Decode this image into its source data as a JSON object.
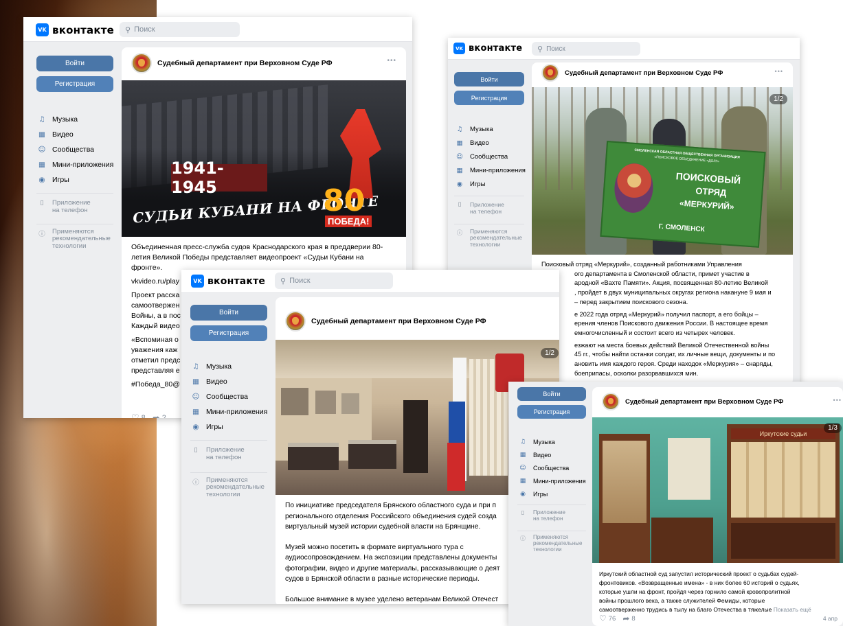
{
  "vk": {
    "brand": "вконтакте",
    "logo_letter": "VK",
    "search_placeholder": "Поиск",
    "login": "Войти",
    "register": "Регистрация",
    "menu": [
      "Музыка",
      "Видео",
      "Сообщества",
      "Мини-приложения",
      "Игры"
    ],
    "app_link_1": "Приложение",
    "app_link_2": "на телефон",
    "rec_1": "Применяются",
    "rec_2": "рекомендательные",
    "rec_3": "технологии"
  },
  "colors": {
    "accent": "#0077ff",
    "button": "#4a76a8",
    "link": "#2a5885",
    "muted": "#818c99"
  },
  "page_name": "Судебный департамент при Верховном Суде РФ",
  "post1": {
    "years": "1941-1945",
    "slogan": "СУДЬИ КУБАНИ НА ФРОНТЕ",
    "badge_80": "80",
    "badge_pobeda": "ПОБЕДА!",
    "text_1": "Объединенная пресс-служба судов Краснодарского края в преддверии 80-",
    "text_2": "летия Великой Победы представляет видеопроект «Судьи Кубани на",
    "text_3": "фронте».",
    "link": "vkvideo.ru/play",
    "p2_1": "Проект расска",
    "p2_2": "самоотвержен",
    "p2_3": "Войны, а в пос",
    "p2_4": "Каждый видео",
    "p3_1": "«Вспоминая о",
    "p3_2": "уважения каж",
    "p3_3": "отметил предс",
    "p3_4": "представляя е",
    "hashtag": "#Победа_80@",
    "likes": "8",
    "shares": "2"
  },
  "post2": {
    "counter": "1/2",
    "flag_1": "СМОЛЕНСКАЯ ОБЛАСТНАЯ ОБЩЕСТВЕННАЯ ОРГАНИЗАЦИЯ",
    "flag_2": "«ПОИСКОВОЕ ОБЪЕДИНЕНИЕ «ДОЛГ»",
    "flag_3": "ПОИСКОВЫЙ",
    "flag_4": "ОТРЯД",
    "flag_5": "«МЕРКУРИЙ»",
    "flag_6": "Г. СМОЛЕНСК",
    "t1": "Поисковый отряд «Меркурий», созданный работниками Управления",
    "t2": "ого департамента в Смоленской области, примет участие в",
    "t3": "ародной «Вахте Памяти». Акция, посвященная 80-летию Великой",
    "t4": ", пройдет в двух муниципальных округах региона накануне 9 мая и",
    "t5": "– перед закрытием поискового сезона.",
    "t6": "е 2022 года отряд «Меркурий» получил паспорт, а его бойцы –",
    "t7": "ерения членов Поискового движения России. В настоящее время",
    "t8": "емногочисленный и состоит всего из четырех человек.",
    "t9": "езжают на места боевых действий Великой Отечественной войны",
    "t10": "45 гг., чтобы найти останки солдат, их личные вещи, документы и по",
    "t11": "ановить имя каждого героя. Среди находок «Меркурия» – снаряды,",
    "t12": "боеприпасы, осколки разорвавшихся мин."
  },
  "post3": {
    "counter": "1/2",
    "t1": "По инициативе председателя Брянского областного суда и при п",
    "t2": "регионального отделения Российского объединения судей созда",
    "t3": "виртуальный музей истории судебной власти на Брянщине.",
    "t4": "Музей можно посетить в формате виртуального тура с",
    "t5": "аудиосопровождением. На экспозиции представлены документы",
    "t6": "фотографии, видео и другие материалы, рассказывающие о деят",
    "t7": "судов в Брянской области в разные исторические периоды.",
    "t8": "Большое внимание в музее уделено ветеранам Великой Отечест"
  },
  "post4": {
    "counter": "1/3",
    "banner": "Иркутские судьи",
    "t1": "Иркутский областной суд запустил исторический проект о судьбах судей-",
    "t2": "фронтовиков. «Возвращенные имена» - в них более 60 историй о судьях,",
    "t3": "которые ушли на фронт, пройдя через горнило самой кровопролитной",
    "t4": "войны прошлого века, а также служителей Фемиды, которые",
    "t5": "самоотверженно трудись в тылу на благо Отечества в тяжелые",
    "more": "Показать ещё",
    "likes": "76",
    "shares": "8",
    "date": "4 апр"
  }
}
